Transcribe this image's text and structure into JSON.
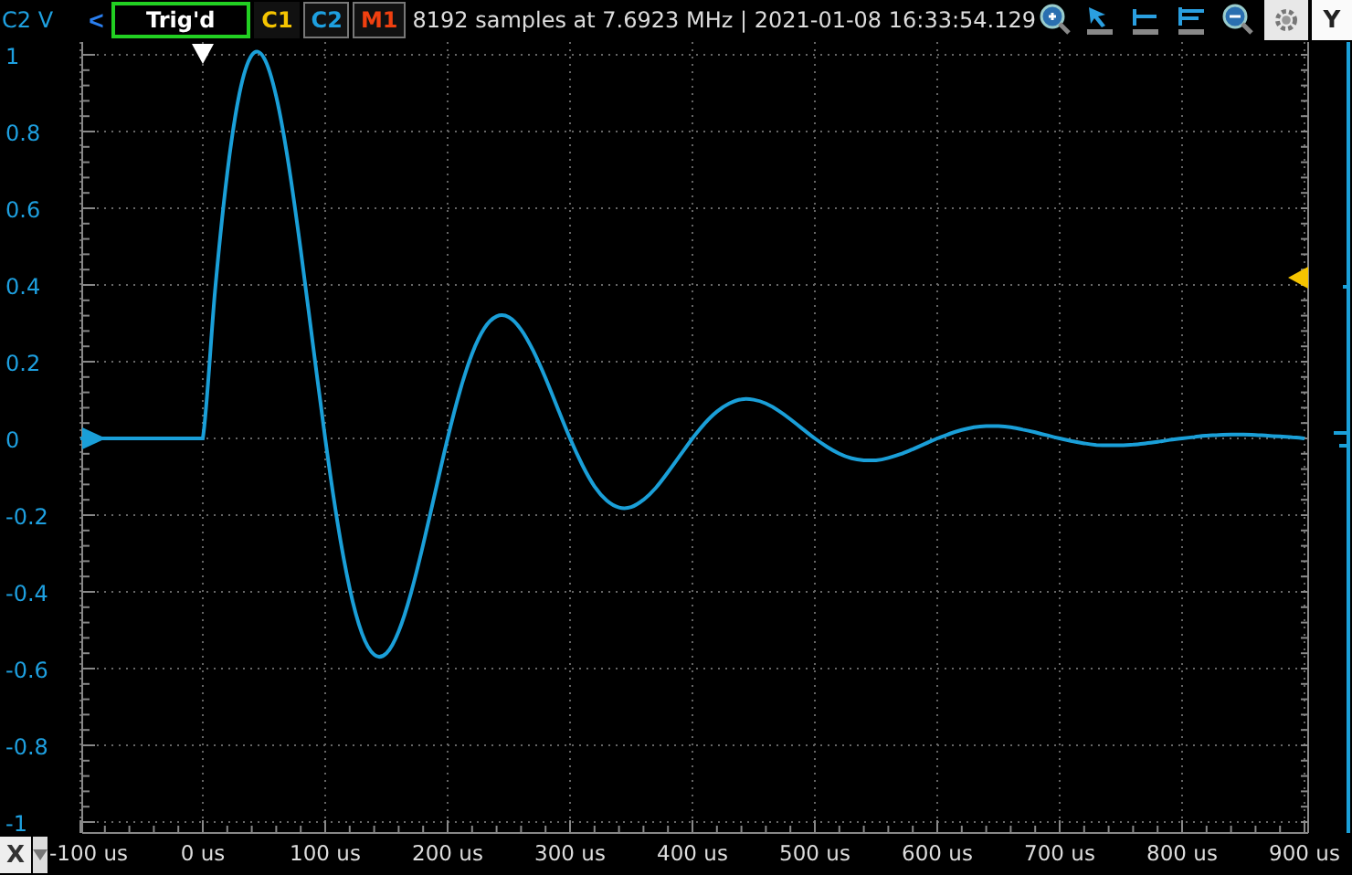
{
  "toolbar": {
    "channel_unit": "C2 V",
    "back_button": "<",
    "trigger_status": "Trig'd",
    "channels": [
      {
        "label": "C1",
        "color": "#f5c400",
        "selected": false
      },
      {
        "label": "C2",
        "color": "#1ea0e0",
        "selected": true
      },
      {
        "label": "M1",
        "color": "#f04010",
        "selected": true
      }
    ],
    "info": "8192 samples at 7.6923 MHz | 2021-01-08 16:33:54.129",
    "y_button": "Y"
  },
  "x_button": "X",
  "chart_data": {
    "type": "line",
    "grid": true,
    "x": [
      -100,
      -90,
      -80,
      -70,
      -60,
      -50,
      -40,
      -30,
      -20,
      -10,
      0,
      10,
      20,
      30,
      40,
      50,
      60,
      70,
      80,
      90,
      100,
      110,
      120,
      130,
      140,
      150,
      160,
      170,
      180,
      190,
      200,
      210,
      220,
      230,
      240,
      250,
      260,
      270,
      280,
      290,
      300,
      310,
      320,
      330,
      340,
      350,
      360,
      370,
      380,
      390,
      400,
      410,
      420,
      430,
      440,
      450,
      460,
      470,
      480,
      490,
      500,
      510,
      520,
      530,
      540,
      550,
      560,
      570,
      580,
      590,
      600,
      610,
      620,
      630,
      640,
      650,
      660,
      670,
      680,
      690,
      700,
      710,
      720,
      730,
      740,
      750,
      760,
      770,
      780,
      790,
      800,
      810,
      820,
      830,
      840,
      850,
      860,
      870,
      880,
      890,
      900
    ],
    "series": [
      {
        "color": "#1a9fd8",
        "values": [
          0,
          0,
          0,
          0,
          0,
          0,
          0,
          0,
          0,
          0,
          0,
          0.385,
          0.692,
          0.9,
          0.999,
          0.992,
          0.891,
          0.716,
          0.491,
          0.244,
          0,
          -0.218,
          -0.391,
          -0.508,
          -0.564,
          -0.56,
          -0.503,
          -0.404,
          -0.277,
          -0.138,
          0,
          0.123,
          0.221,
          0.287,
          0.318,
          0.316,
          0.284,
          0.228,
          0.157,
          0.078,
          0,
          -0.069,
          -0.125,
          -0.162,
          -0.18,
          -0.179,
          -0.16,
          -0.129,
          -0.088,
          -0.044,
          0,
          0.039,
          0.07,
          0.091,
          0.102,
          0.101,
          0.091,
          0.073,
          0.05,
          0.025,
          0,
          -0.022,
          -0.04,
          -0.052,
          -0.057,
          -0.057,
          -0.051,
          -0.041,
          -0.028,
          -0.014,
          0,
          0.012,
          0.022,
          0.029,
          0.032,
          0.032,
          0.029,
          0.023,
          0.016,
          0.008,
          0,
          -0.007,
          -0.013,
          -0.017,
          -0.018,
          -0.018,
          -0.016,
          -0.013,
          -0.009,
          -0.004,
          0,
          0.004,
          0.007,
          0.009,
          0.01,
          0.01,
          0.009,
          0.007,
          0.005,
          0.003,
          0
        ]
      }
    ],
    "xlim": [
      -100,
      900
    ],
    "ylim": [
      -1,
      1
    ],
    "xticks": [
      {
        "value": -100,
        "label": "-100 us"
      },
      {
        "value": 0,
        "label": "0 us"
      },
      {
        "value": 100,
        "label": "100 us"
      },
      {
        "value": 200,
        "label": "200 us"
      },
      {
        "value": 300,
        "label": "300 us"
      },
      {
        "value": 400,
        "label": "400 us"
      },
      {
        "value": 500,
        "label": "500 us"
      },
      {
        "value": 600,
        "label": "600 us"
      },
      {
        "value": 700,
        "label": "700 us"
      },
      {
        "value": 800,
        "label": "800 us"
      },
      {
        "value": 900,
        "label": "900 us"
      }
    ],
    "yticks": [
      {
        "value": 1,
        "label": "1"
      },
      {
        "value": 0.8,
        "label": "0.8"
      },
      {
        "value": 0.6,
        "label": "0.6"
      },
      {
        "value": 0.4,
        "label": "0.4"
      },
      {
        "value": 0.2,
        "label": "0.2"
      },
      {
        "value": 0,
        "label": "0"
      },
      {
        "value": -0.2,
        "label": "-0.2"
      },
      {
        "value": -0.4,
        "label": "-0.4"
      },
      {
        "value": -0.6,
        "label": "-0.6"
      },
      {
        "value": -0.8,
        "label": "-0.8"
      },
      {
        "value": -1,
        "label": "-1"
      }
    ]
  }
}
